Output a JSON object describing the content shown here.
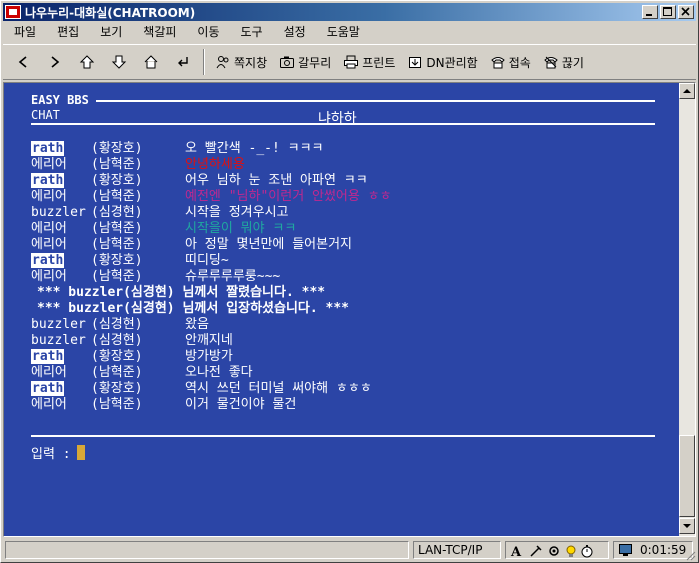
{
  "window": {
    "title": "나우누리-대화실(CHATROOM)",
    "buttons": [
      "minimize",
      "maximize",
      "close"
    ]
  },
  "menu": [
    "파일",
    "편집",
    "보기",
    "책갈피",
    "이동",
    "도구",
    "설정",
    "도움말"
  ],
  "toolbar": {
    "nav_icons": [
      "arrow-left-icon",
      "arrow-right-icon",
      "arrow-up-icon",
      "arrow-down-icon",
      "home-icon",
      "return-icon"
    ],
    "buttons": [
      {
        "label": "쪽지창",
        "icon": "people-icon"
      },
      {
        "label": "갈무리",
        "icon": "camera-icon"
      },
      {
        "label": "프린트",
        "icon": "printer-icon"
      },
      {
        "label": "DN관리함",
        "icon": "download-manager-icon"
      },
      {
        "label": "접속",
        "icon": "phone-icon"
      },
      {
        "label": "끊기",
        "icon": "phone-hangup-icon"
      }
    ]
  },
  "terminal": {
    "bbs_title": "EASY BBS",
    "section_label": "CHAT",
    "room_name": "냐하하",
    "input_label": "입력 :",
    "colors": {
      "background": "#2b45a6",
      "text": "#ffffff",
      "red": "#e01010",
      "purple": "#c02890",
      "teal": "#20a8a0",
      "cursor": "#d8a838"
    },
    "lines": [
      {
        "nick": "rath",
        "highlight": true,
        "name": "(황장호)",
        "msg": "오 빨간색 -_-! ㅋㅋㅋ",
        "color": ""
      },
      {
        "nick": "에리어",
        "highlight": false,
        "name": "(남혁준)",
        "msg": "안녕하세용",
        "color": "red"
      },
      {
        "nick": "rath",
        "highlight": true,
        "name": "(황장호)",
        "msg": "어우 님하 눈 조낸 아파연 ㅋㅋ",
        "color": ""
      },
      {
        "nick": "에리어",
        "highlight": false,
        "name": "(남혁준)",
        "msg": "예전엔 \"님하\"이런거 안썼어용 ㅎㅎ",
        "color": "purple"
      },
      {
        "nick": "buzzler",
        "highlight": false,
        "name": "(심경현)",
        "msg": "시작을 정겨우시고",
        "color": ""
      },
      {
        "nick": "에리어",
        "highlight": false,
        "name": "(남혁준)",
        "msg": "시작을이 뭐야 ㅋㅋ",
        "color": "teal"
      },
      {
        "nick": "에리어",
        "highlight": false,
        "name": "(남혁준)",
        "msg": "아 정말 몇년만에 들어본거지",
        "color": ""
      },
      {
        "nick": "rath",
        "highlight": true,
        "name": "(황장호)",
        "msg": "띠디딩~",
        "color": ""
      },
      {
        "nick": "에리어",
        "highlight": false,
        "name": "(남혁준)",
        "msg": "슈루루루루룽~~~",
        "color": ""
      },
      {
        "system": "*** buzzler(심경현) 님께서 짤렸습니다. ***"
      },
      {
        "system": "*** buzzler(심경현) 님께서 입장하셨습니다. ***"
      },
      {
        "nick": "buzzler",
        "highlight": false,
        "name": "(심경현)",
        "msg": "왔음",
        "color": ""
      },
      {
        "nick": "buzzler",
        "highlight": false,
        "name": "(심경현)",
        "msg": "안깨지네",
        "color": ""
      },
      {
        "nick": "rath",
        "highlight": true,
        "name": "(황장호)",
        "msg": "방가방가",
        "color": ""
      },
      {
        "nick": "에리어",
        "highlight": false,
        "name": "(남혁준)",
        "msg": "오나전 좋다",
        "color": ""
      },
      {
        "nick": "rath",
        "highlight": true,
        "name": "(황장호)",
        "msg": "역시 쓰던 터미널 써야해 ㅎㅎㅎ",
        "color": ""
      },
      {
        "nick": "에리어",
        "highlight": false,
        "name": "(남혁준)",
        "msg": "이거 물건이야 물건",
        "color": ""
      }
    ]
  },
  "statusbar": {
    "connection": "LAN-TCP/IP",
    "time": "0:01:59",
    "icons": [
      "font-icon",
      "tools-icon",
      "settings-icon",
      "lightbulb-icon",
      "stopwatch-icon",
      "monitor-icon"
    ]
  }
}
